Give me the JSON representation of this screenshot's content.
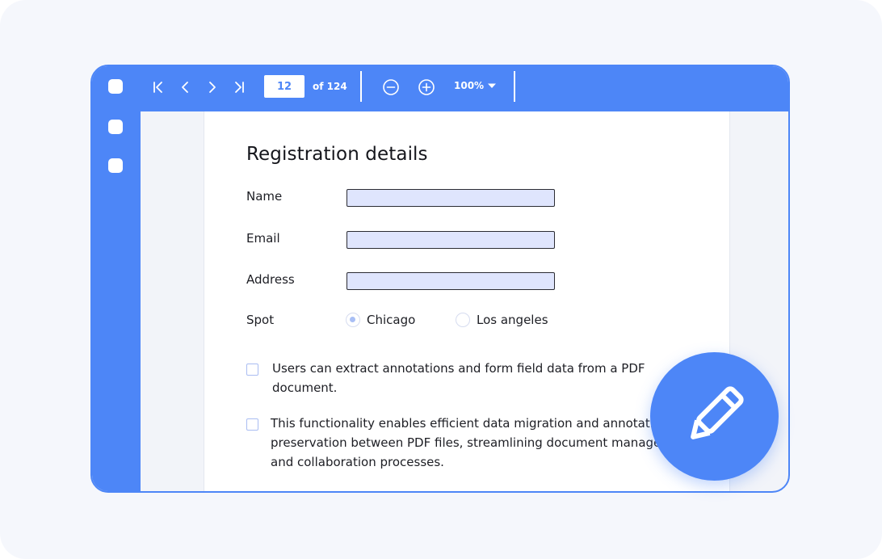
{
  "toolbar": {
    "current_page": "12",
    "page_total_label": "of 124",
    "zoom_level": "100%",
    "icons": [
      "first-page-icon",
      "prev-page-icon",
      "next-page-icon",
      "last-page-icon",
      "zoom-out-icon",
      "zoom-in-icon",
      "caret-down-icon"
    ]
  },
  "form": {
    "title": "Registration details",
    "fields": [
      {
        "label": "Name",
        "value": ""
      },
      {
        "label": "Email",
        "value": ""
      },
      {
        "label": "Address",
        "value": ""
      }
    ],
    "spot": {
      "label": "Spot",
      "options": [
        {
          "label": "Chicago",
          "selected": true
        },
        {
          "label": "Los angeles",
          "selected": false
        }
      ]
    },
    "checkboxes": [
      {
        "line1": "Users can extract annotations and form field data from a PDF",
        "line2": "document.",
        "checked": false
      },
      {
        "line1": "This functionality enables efficient data migration and annotation",
        "line2": "preservation between PDF files, streamlining document management",
        "line3": "and collaboration processes.",
        "checked": false
      }
    ]
  },
  "edit_button": {
    "icon": "pencil-icon"
  },
  "colors": {
    "accent": "#4d86f7",
    "field_fill": "#dfe5fd",
    "background": "#f5f7fc"
  }
}
